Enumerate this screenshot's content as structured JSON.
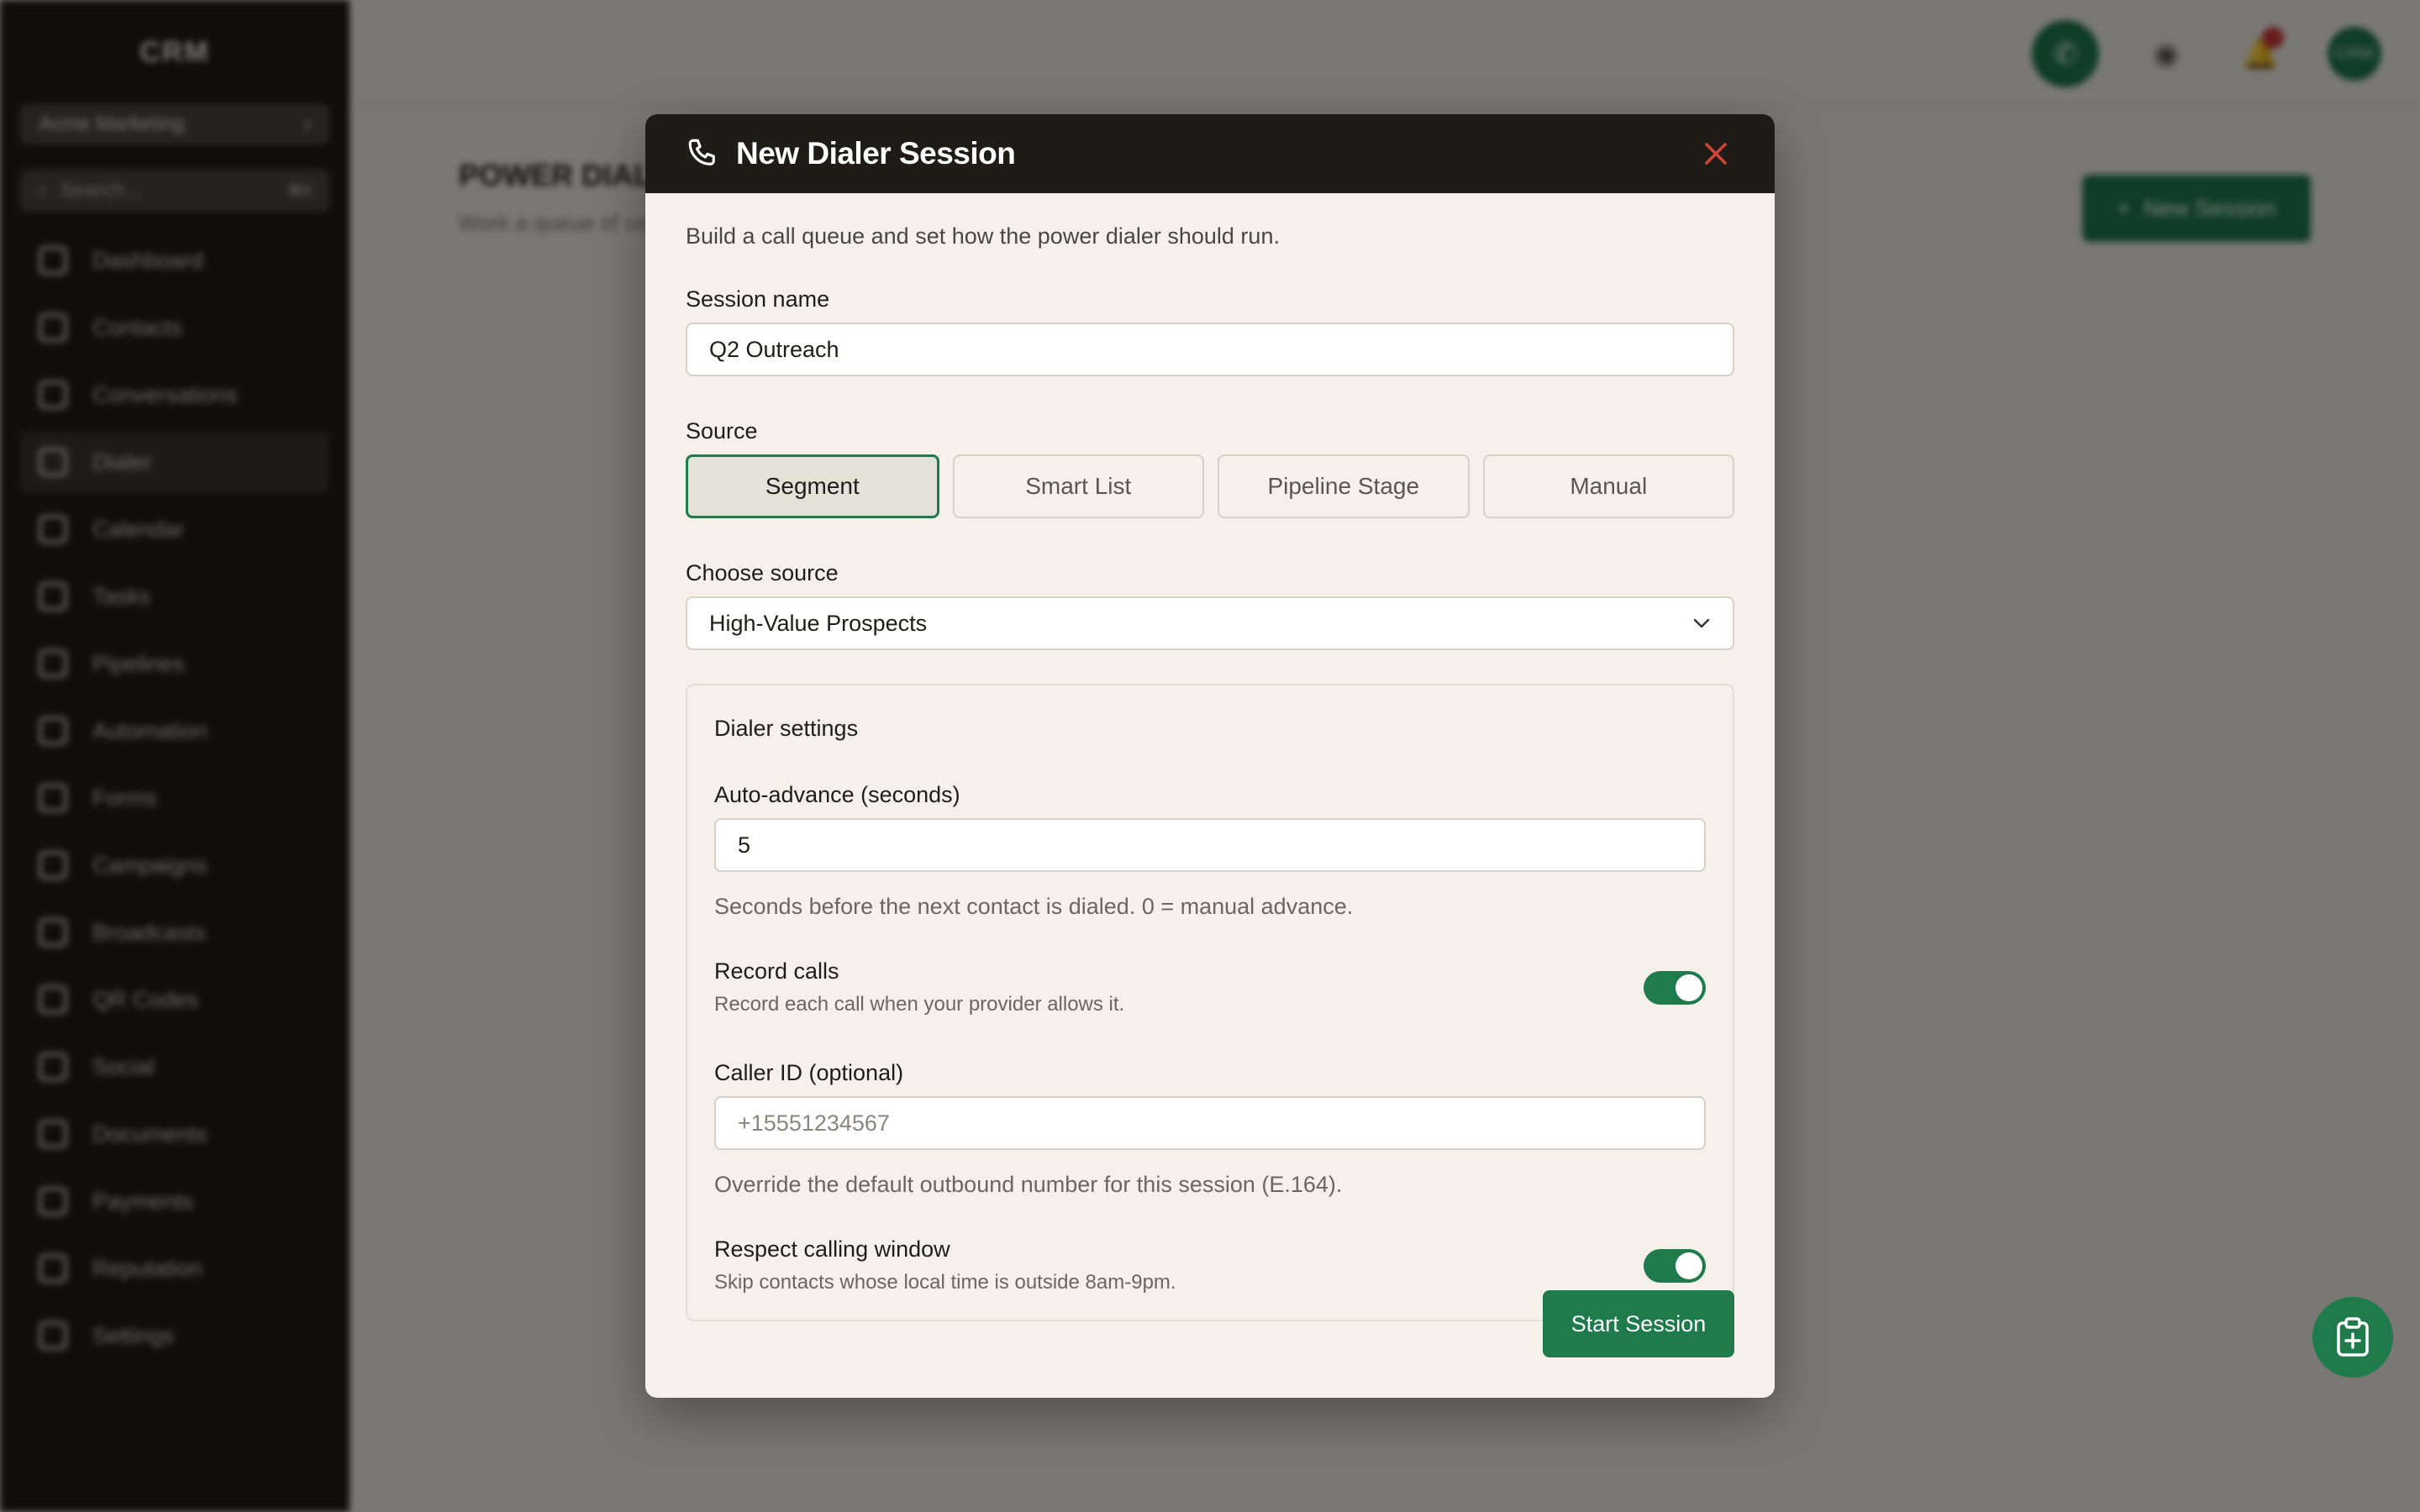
{
  "app": {
    "brand": "CRM",
    "workspace": "Acme Marketing",
    "search_placeholder": "Search...",
    "search_shortcut": "⌘K",
    "nav": [
      {
        "label": "Dashboard",
        "icon": "dashboard-icon"
      },
      {
        "label": "Contacts",
        "icon": "contacts-icon"
      },
      {
        "label": "Conversations",
        "icon": "chat-icon"
      },
      {
        "label": "Dialer",
        "icon": "phone-icon",
        "active": true
      },
      {
        "label": "Calendar",
        "icon": "calendar-icon"
      },
      {
        "label": "Tasks",
        "icon": "folder-icon"
      },
      {
        "label": "Pipelines",
        "icon": "pipeline-icon"
      },
      {
        "label": "Automation",
        "icon": "automation-icon"
      },
      {
        "label": "Forms",
        "icon": "form-icon"
      },
      {
        "label": "Campaigns",
        "icon": "mail-icon"
      },
      {
        "label": "Broadcasts",
        "icon": "mobile-icon"
      },
      {
        "label": "QR Codes",
        "icon": "qr-icon"
      },
      {
        "label": "Social",
        "icon": "share-icon"
      },
      {
        "label": "Documents",
        "icon": "document-icon"
      },
      {
        "label": "Payments",
        "icon": "payment-icon"
      },
      {
        "label": "Reputation",
        "icon": "star-icon"
      },
      {
        "label": "Settings",
        "icon": "gear-icon"
      }
    ],
    "page_title": "POWER DIALER",
    "page_subtitle": "Work a queue of contacts",
    "new_session_label": "New Session",
    "avatar_initials": "CRM"
  },
  "modal": {
    "title": "New Dialer Session",
    "intro": "Build a call queue and set how the power dialer should run.",
    "session_name_label": "Session name",
    "session_name_value": "Q2 Outreach",
    "source_label": "Source",
    "source_options": [
      "Segment",
      "Smart List",
      "Pipeline Stage",
      "Manual"
    ],
    "source_selected": "Segment",
    "choose_source_label": "Choose source",
    "choose_source_value": "High-Value Prospects",
    "settings": {
      "title": "Dialer settings",
      "auto_advance_label": "Auto-advance (seconds)",
      "auto_advance_value": "5",
      "auto_advance_hint": "Seconds before the next contact is dialed. 0 = manual advance.",
      "record_calls_label": "Record calls",
      "record_calls_desc": "Record each call when your provider allows it.",
      "record_calls_on": true,
      "caller_id_label": "Caller ID (optional)",
      "caller_id_placeholder": "+15551234567",
      "caller_id_hint": "Override the default outbound number for this session (E.164).",
      "respect_window_label": "Respect calling window",
      "respect_window_desc": "Skip contacts whose local time is outside 8am-9pm.",
      "respect_window_on": true
    },
    "start_label": "Start Session"
  },
  "colors": {
    "accent": "#1f7a4c",
    "modal_header": "#1f1c18",
    "modal_bg": "#f5f1ea",
    "close": "#d0453a"
  }
}
